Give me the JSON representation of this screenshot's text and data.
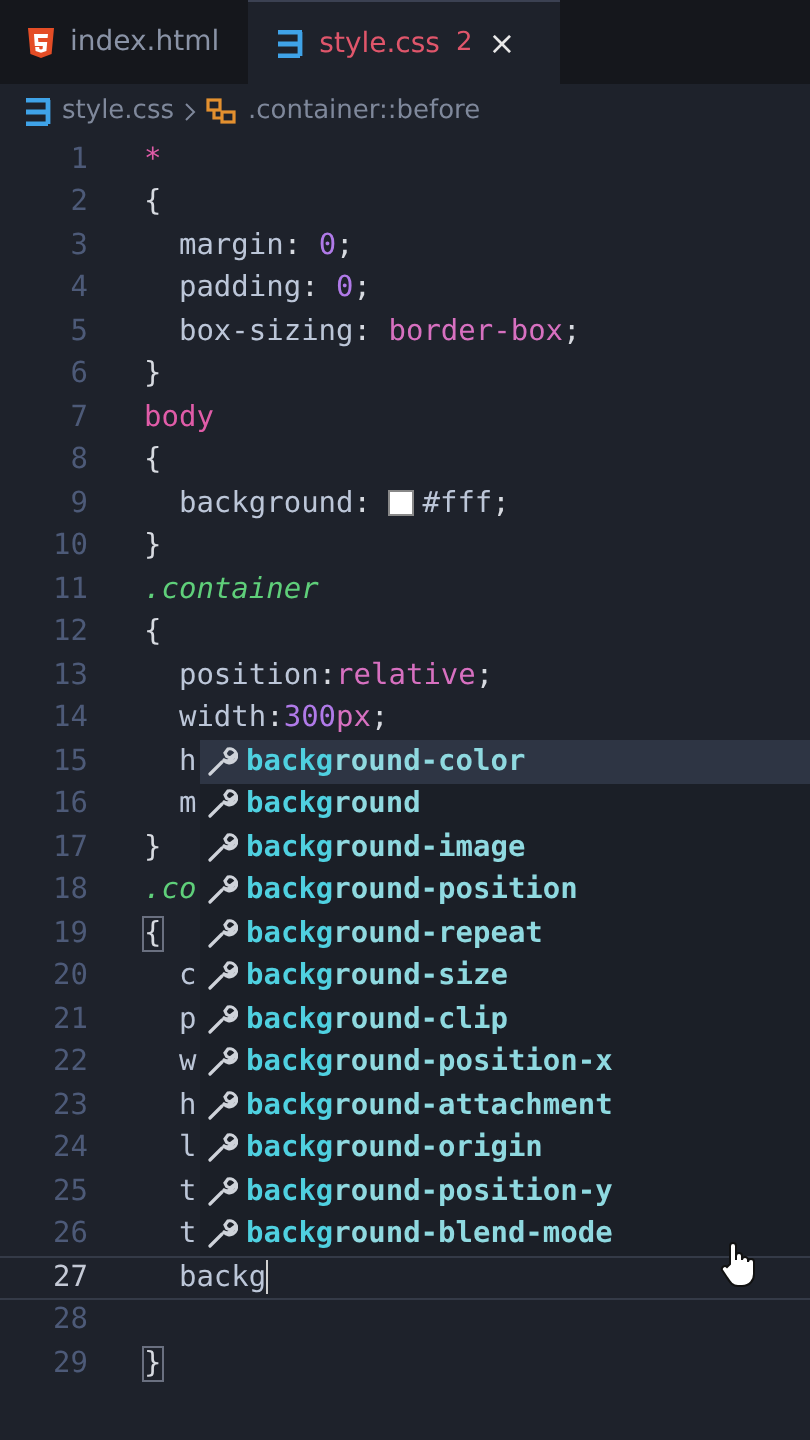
{
  "tabs": [
    {
      "label": "index.html",
      "kind": "html",
      "selected": false
    },
    {
      "label": "style.css",
      "kind": "css",
      "selected": true,
      "problems": "2",
      "close": "×"
    }
  ],
  "breadcrumb": {
    "file": "style.css",
    "symbol": ".container::before"
  },
  "lines": [
    {
      "number": "1",
      "current": false,
      "tokens": [
        {
          "text": "*",
          "kind": "selector"
        }
      ]
    },
    {
      "number": "2",
      "current": false,
      "tokens": [
        {
          "text": "{",
          "kind": "punct"
        }
      ]
    },
    {
      "number": "3",
      "current": false,
      "tokens": [
        {
          "text": "  margin",
          "kind": "prop"
        },
        {
          "text": ": ",
          "kind": "punct"
        },
        {
          "text": "0",
          "kind": "number"
        },
        {
          "text": ";",
          "kind": "punct"
        }
      ]
    },
    {
      "number": "4",
      "current": false,
      "tokens": [
        {
          "text": "  padding",
          "kind": "prop"
        },
        {
          "text": ": ",
          "kind": "punct"
        },
        {
          "text": "0",
          "kind": "number"
        },
        {
          "text": ";",
          "kind": "punct"
        }
      ]
    },
    {
      "number": "5",
      "current": false,
      "tokens": [
        {
          "text": "  box-sizing",
          "kind": "prop"
        },
        {
          "text": ": ",
          "kind": "punct"
        },
        {
          "text": "border-box",
          "kind": "value"
        },
        {
          "text": ";",
          "kind": "punct"
        }
      ]
    },
    {
      "number": "6",
      "current": false,
      "tokens": [
        {
          "text": "}",
          "kind": "punct"
        }
      ]
    },
    {
      "number": "7",
      "current": false,
      "tokens": [
        {
          "text": "body",
          "kind": "selector"
        }
      ]
    },
    {
      "number": "8",
      "current": false,
      "tokens": [
        {
          "text": "{",
          "kind": "punct"
        }
      ]
    },
    {
      "number": "9",
      "current": false,
      "tokens": [
        {
          "text": "  background",
          "kind": "prop"
        },
        {
          "text": ": ",
          "kind": "punct"
        },
        {
          "text": "#fff",
          "kind": "color",
          "color": "#ffffff"
        },
        {
          "text": ";",
          "kind": "punct"
        }
      ]
    },
    {
      "number": "10",
      "current": false,
      "tokens": [
        {
          "text": "}",
          "kind": "punct"
        }
      ]
    },
    {
      "number": "11",
      "current": false,
      "tokens": [
        {
          "text": ".container",
          "kind": "class"
        }
      ]
    },
    {
      "number": "12",
      "current": false,
      "tokens": [
        {
          "text": "{",
          "kind": "punct"
        }
      ]
    },
    {
      "number": "13",
      "current": false,
      "tokens": [
        {
          "text": "  position",
          "kind": "prop"
        },
        {
          "text": ":",
          "kind": "punct"
        },
        {
          "text": "relative",
          "kind": "value"
        },
        {
          "text": ";",
          "kind": "punct"
        }
      ]
    },
    {
      "number": "14",
      "current": false,
      "tokens": [
        {
          "text": "  width",
          "kind": "prop"
        },
        {
          "text": ":",
          "kind": "punct"
        },
        {
          "text": "300",
          "kind": "number"
        },
        {
          "text": "px",
          "kind": "value"
        },
        {
          "text": ";",
          "kind": "punct"
        }
      ]
    },
    {
      "number": "15",
      "current": false,
      "tokens": [
        {
          "text": "  h",
          "kind": "prop"
        }
      ]
    },
    {
      "number": "16",
      "current": false,
      "tokens": [
        {
          "text": "  m",
          "kind": "prop"
        }
      ]
    },
    {
      "number": "17",
      "current": false,
      "tokens": [
        {
          "text": "}",
          "kind": "punct"
        }
      ]
    },
    {
      "number": "18",
      "current": false,
      "tokens": [
        {
          "text": ".co",
          "kind": "class"
        }
      ]
    },
    {
      "number": "19",
      "current": false,
      "tokens": [
        {
          "text": "{",
          "kind": "bracket-match"
        }
      ]
    },
    {
      "number": "20",
      "current": false,
      "tokens": [
        {
          "text": "  c",
          "kind": "prop"
        }
      ]
    },
    {
      "number": "21",
      "current": false,
      "tokens": [
        {
          "text": "  p",
          "kind": "prop"
        }
      ]
    },
    {
      "number": "22",
      "current": false,
      "tokens": [
        {
          "text": "  w",
          "kind": "prop"
        }
      ]
    },
    {
      "number": "23",
      "current": false,
      "tokens": [
        {
          "text": "  h",
          "kind": "prop"
        }
      ]
    },
    {
      "number": "24",
      "current": false,
      "tokens": [
        {
          "text": "  l",
          "kind": "prop"
        }
      ]
    },
    {
      "number": "25",
      "current": false,
      "tokens": [
        {
          "text": "  t",
          "kind": "prop"
        }
      ]
    },
    {
      "number": "26",
      "current": false,
      "tokens": [
        {
          "text": "  t",
          "kind": "prop"
        }
      ]
    },
    {
      "number": "27",
      "current": true,
      "tokens": [
        {
          "text": "  backg",
          "kind": "prop"
        }
      ]
    },
    {
      "number": "28",
      "current": false
    },
    {
      "number": "29",
      "current": false,
      "tokens": [
        {
          "text": "}",
          "kind": "bracket-match"
        }
      ]
    }
  ],
  "suggestions": [
    {
      "match": "backg",
      "rest": "round-color",
      "selected": true
    },
    {
      "match": "backg",
      "rest": "round",
      "selected": false
    },
    {
      "match": "backg",
      "rest": "round-image",
      "selected": false
    },
    {
      "match": "backg",
      "rest": "round-position",
      "selected": false
    },
    {
      "match": "backg",
      "rest": "round-repeat",
      "selected": false
    },
    {
      "match": "backg",
      "rest": "round-size",
      "selected": false
    },
    {
      "match": "backg",
      "rest": "round-clip",
      "selected": false
    },
    {
      "match": "backg",
      "rest": "round-position-x",
      "selected": false
    },
    {
      "match": "backg",
      "rest": "round-attachment",
      "selected": false
    },
    {
      "match": "backg",
      "rest": "round-origin",
      "selected": false
    },
    {
      "match": "backg",
      "rest": "round-position-y",
      "selected": false
    },
    {
      "match": "backg",
      "rest": "round-blend-mode",
      "selected": false
    }
  ]
}
